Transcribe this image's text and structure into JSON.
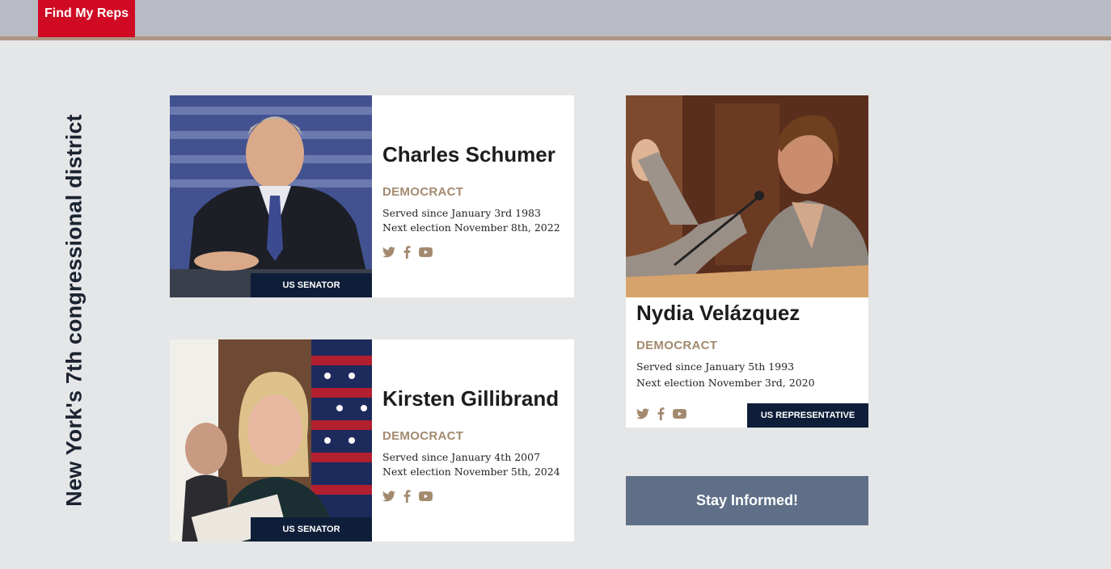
{
  "header": {
    "brand": "Find My Reps"
  },
  "district_title": "New York's 7th congressional district",
  "reps": [
    {
      "name": "Charles Schumer",
      "party": "DEMOCRACT",
      "served": "Served since January 3rd 1983",
      "next": "Next election November 8th, 2022",
      "role": "US SENATOR"
    },
    {
      "name": "Kirsten Gillibrand",
      "party": "DEMOCRACT",
      "served": "Served since January 4th 2007",
      "next": "Next election November 5th, 2024",
      "role": "US SENATOR"
    },
    {
      "name": "Nydia Velázquez",
      "party": "DEMOCRACT",
      "served": "Served since January 5th 1993",
      "next": "Next election November 3rd, 2020",
      "role": "US REPRESENTATIVE"
    }
  ],
  "socials": {
    "icons": [
      "twitter-icon",
      "facebook-icon",
      "youtube-icon"
    ]
  },
  "cta": {
    "label": "Stay Informed!"
  },
  "colors": {
    "brand": "#d10a24",
    "navy": "#0f1e38",
    "party": "#a38a6f",
    "cta": "#5f6f88"
  }
}
